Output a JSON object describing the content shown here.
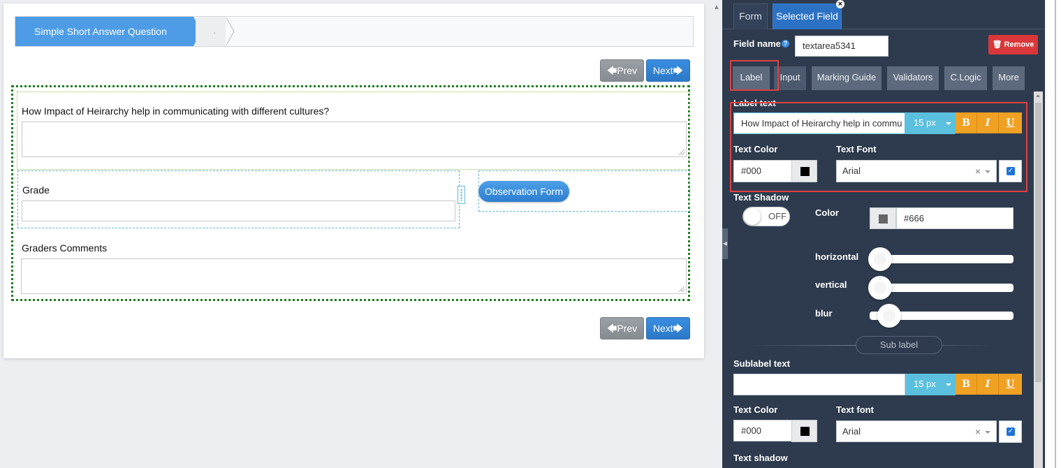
{
  "preview": {
    "wizard": {
      "step1": "Simple Short Answer Question",
      "step2": "."
    },
    "nav": {
      "prev": "Prev",
      "next": "Next"
    },
    "question_label": "How Impact of Heirarchy help in communicating with different cultures?",
    "grade_label": "Grade",
    "observation_button": "Observation Form",
    "comments_label": "Graders Comments"
  },
  "panel": {
    "tabs": [
      "Form",
      "Selected Field"
    ],
    "field_name_label": "Field name",
    "field_name_value": "textarea5341",
    "remove_label": "Remove",
    "sub_tabs": [
      "Label",
      "Input",
      "Marking Guide",
      "Validators",
      "C.Logic",
      "More"
    ],
    "label_section": {
      "title": "Label text",
      "text_value": "How Impact of Heirarchy help in commu",
      "size": "15 px",
      "text_color_label": "Text Color",
      "text_color_value": "#000",
      "text_font_label": "Text Font",
      "text_font_value": "Arial"
    },
    "shadow": {
      "title": "Text Shadow",
      "toggle": "OFF",
      "color_label": "Color",
      "color_value": "#666",
      "horizontal": "horizontal",
      "vertical": "vertical",
      "blur": "blur"
    },
    "sub_label_divider": "Sub label",
    "sublabel_section": {
      "title": "Sublabel text",
      "size": "15 px",
      "text_color_label": "Text Color",
      "text_color_value": "#000",
      "text_font_label": "Text font",
      "text_font_value": "Arial",
      "shadow_title": "Text shadow"
    },
    "format_buttons": [
      "B",
      "I",
      "U"
    ]
  }
}
